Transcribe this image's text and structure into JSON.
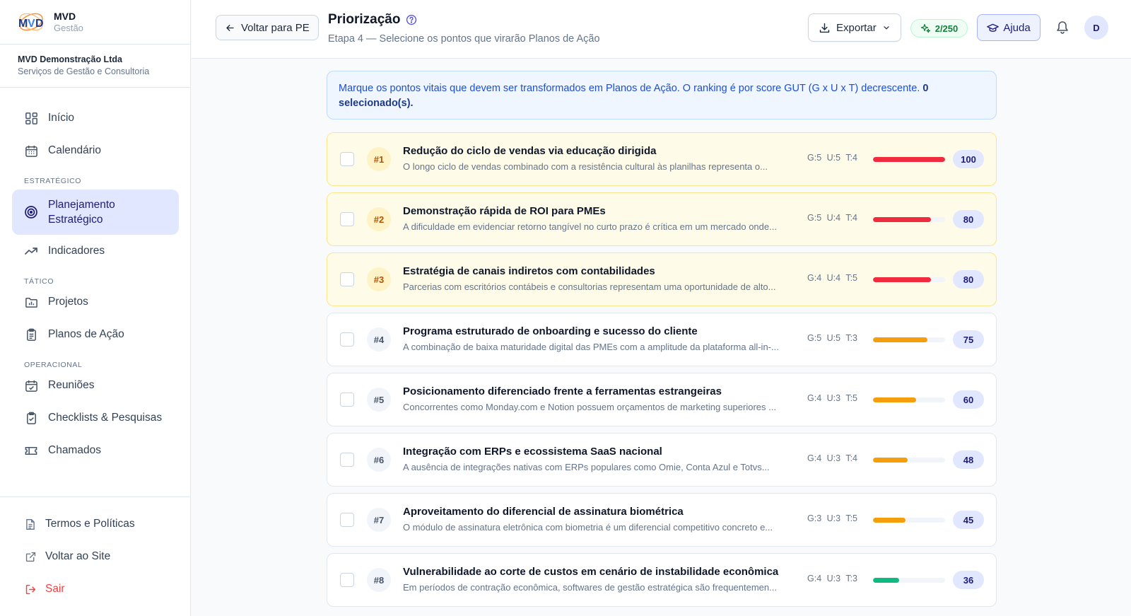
{
  "brand": {
    "name": "MVD",
    "sub": "Gestão"
  },
  "company": {
    "name": "MVD Demonstração Ltda",
    "desc": "Serviços de Gestão e Consultoria"
  },
  "nav": {
    "inicio": "Início",
    "calendario": "Calendário",
    "section_estrategico": "ESTRATÉGICO",
    "planejamento": "Planejamento Estratégico",
    "indicadores": "Indicadores",
    "section_tatico": "TÁTICO",
    "projetos": "Projetos",
    "planos": "Planos de Ação",
    "section_operacional": "OPERACIONAL",
    "reunioes": "Reuniões",
    "checklists": "Checklists & Pesquisas",
    "chamados": "Chamados"
  },
  "bottom": {
    "termos": "Termos e Políticas",
    "voltar_site": "Voltar ao Site",
    "sair": "Sair"
  },
  "header": {
    "back_label": "Voltar para PE",
    "title": "Priorização",
    "subtitle": "Etapa 4 — Selecione os pontos que virarão Planos de Ação",
    "export_label": "Exportar",
    "credits": "2/250",
    "help_label": "Ajuda",
    "avatar": "D"
  },
  "info": {
    "text": "Marque os pontos vitais que devem ser transformados em Planos de Ação. O ranking é por score GUT (G x U x T) decrescente. ",
    "selected": "0 selecionado(s)."
  },
  "colors": {
    "red": "#ef2b3d",
    "orange": "#f59e0b",
    "green": "#10b981"
  },
  "items": [
    {
      "rank": "#1",
      "title": "Redução do ciclo de vendas via educação dirigida",
      "desc": "O longo ciclo de vendas combinado com a resistência cultural às planilhas representa o...",
      "gut": "G:5 U:5 T:4",
      "score": "100",
      "level": 1.0,
      "color": "#ef2b3d",
      "top": true
    },
    {
      "rank": "#2",
      "title": "Demonstração rápida de ROI para PMEs",
      "desc": "A dificuldade em evidenciar retorno tangível no curto prazo é crítica em um mercado onde...",
      "gut": "G:5 U:4 T:4",
      "score": "80",
      "level": 0.8,
      "color": "#ef2b3d",
      "top": true
    },
    {
      "rank": "#3",
      "title": "Estratégia de canais indiretos com contabilidades",
      "desc": "Parcerias com escritórios contábeis e consultorias representam uma oportunidade de alto...",
      "gut": "G:4 U:4 T:5",
      "score": "80",
      "level": 0.8,
      "color": "#ef2b3d",
      "top": true
    },
    {
      "rank": "#4",
      "title": "Programa estruturado de onboarding e sucesso do cliente",
      "desc": "A combinação de baixa maturidade digital das PMEs com a amplitude da plataforma all-in-...",
      "gut": "G:5 U:5 T:3",
      "score": "75",
      "level": 0.75,
      "color": "#f59e0b",
      "top": false
    },
    {
      "rank": "#5",
      "title": "Posicionamento diferenciado frente a ferramentas estrangeiras",
      "desc": "Concorrentes como Monday.com e Notion possuem orçamentos de marketing superiores ...",
      "gut": "G:4 U:3 T:5",
      "score": "60",
      "level": 0.6,
      "color": "#f59e0b",
      "top": false
    },
    {
      "rank": "#6",
      "title": "Integração com ERPs e ecossistema SaaS nacional",
      "desc": "A ausência de integrações nativas com ERPs populares como Omie, Conta Azul e Totvs...",
      "gut": "G:4 U:3 T:4",
      "score": "48",
      "level": 0.48,
      "color": "#f59e0b",
      "top": false
    },
    {
      "rank": "#7",
      "title": "Aproveitamento do diferencial de assinatura biométrica",
      "desc": "O módulo de assinatura eletrônica com biometria é um diferencial competitivo concreto e...",
      "gut": "G:3 U:3 T:5",
      "score": "45",
      "level": 0.45,
      "color": "#f59e0b",
      "top": false
    },
    {
      "rank": "#8",
      "title": "Vulnerabilidade ao corte de custos em cenário de instabilidade econômica",
      "desc": "Em períodos de contração econômica, softwares de gestão estratégica são frequentemen...",
      "gut": "G:4 U:3 T:3",
      "score": "36",
      "level": 0.36,
      "color": "#10b981",
      "top": false
    }
  ]
}
